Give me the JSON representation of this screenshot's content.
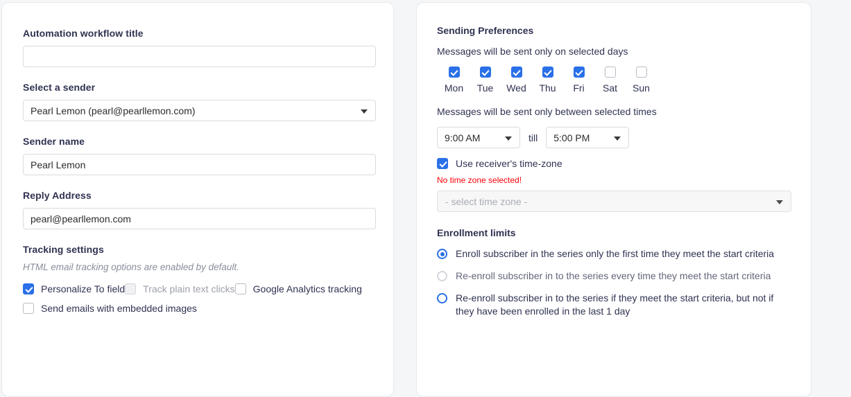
{
  "left_panel": {
    "workflow_title": {
      "label": "Automation workflow title",
      "value": "",
      "placeholder": ""
    },
    "sender": {
      "label": "Select a sender",
      "value": "Pearl Lemon (pearl@pearllemon.com)"
    },
    "sender_name": {
      "label": "Sender name",
      "value": "Pearl Lemon"
    },
    "reply_address": {
      "label": "Reply Address",
      "value": "pearl@pearllemon.com"
    },
    "tracking": {
      "title": "Tracking settings",
      "hint": "HTML email tracking options are enabled by default.",
      "options": [
        {
          "label": "Personalize To field",
          "checked": true,
          "disabled": false
        },
        {
          "label": "Track plain text clicks",
          "checked": false,
          "disabled": true
        },
        {
          "label": "Google Analytics tracking",
          "checked": false,
          "disabled": false
        },
        {
          "label": "Send emails with embedded images",
          "checked": false,
          "disabled": false
        }
      ]
    }
  },
  "right_panel": {
    "sending_preferences": {
      "title": "Sending Preferences",
      "days_description": "Messages will be sent only on selected days",
      "days": [
        {
          "name": "Mon",
          "checked": true
        },
        {
          "name": "Tue",
          "checked": true
        },
        {
          "name": "Wed",
          "checked": true
        },
        {
          "name": "Thu",
          "checked": true
        },
        {
          "name": "Fri",
          "checked": true
        },
        {
          "name": "Sat",
          "checked": false
        },
        {
          "name": "Sun",
          "checked": false
        }
      ],
      "times_description": "Messages will be sent only between selected times",
      "start_time": "9:00 AM",
      "till_label": "till",
      "end_time": "5:00 PM",
      "receiver_timezone": {
        "label": "Use receiver's time-zone",
        "checked": true
      },
      "timezone_error": "No time zone selected!",
      "timezone_placeholder": "- select time zone -"
    },
    "enrollment_limits": {
      "title": "Enrollment limits",
      "options": [
        {
          "label": "Enroll subscriber in the series only the first time they meet the start criteria",
          "selected": true,
          "disabled": false
        },
        {
          "label": "Re-enroll subscriber in to the series every time they meet the start criteria",
          "selected": false,
          "disabled": true
        },
        {
          "label": "Re-enroll subscriber in to the series if they meet the start criteria, but not if they have been enrolled in the last 1 day",
          "selected": false,
          "disabled": false
        }
      ]
    }
  },
  "colors": {
    "accent": "#2a70e8",
    "error": "#fb0007",
    "text": "#2f3251",
    "page_bg": "#f5f6f8"
  }
}
